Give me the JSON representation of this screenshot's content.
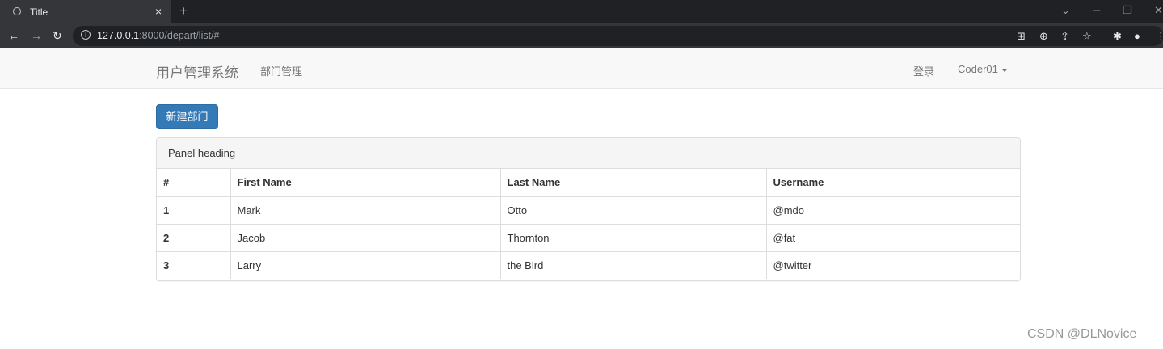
{
  "browser": {
    "tab_title": "Title",
    "tab_close": "×",
    "new_tab": "+",
    "url_host": "127.0.0.1",
    "url_rest": ":8000/depart/list/#"
  },
  "navbar": {
    "brand": "用户管理系统",
    "link_depart": "部门管理",
    "login": "登录",
    "user": "Coder01"
  },
  "actions": {
    "new_depart": "新建部门"
  },
  "panel": {
    "heading": "Panel heading",
    "columns": [
      "#",
      "First Name",
      "Last Name",
      "Username"
    ],
    "rows": [
      [
        "1",
        "Mark",
        "Otto",
        "@mdo"
      ],
      [
        "2",
        "Jacob",
        "Thornton",
        "@fat"
      ],
      [
        "3",
        "Larry",
        "the Bird",
        "@twitter"
      ]
    ]
  },
  "watermark": "CSDN @DLNovice",
  "colors": {
    "primary": "#337ab7",
    "navbar_bg": "#f8f8f8"
  }
}
